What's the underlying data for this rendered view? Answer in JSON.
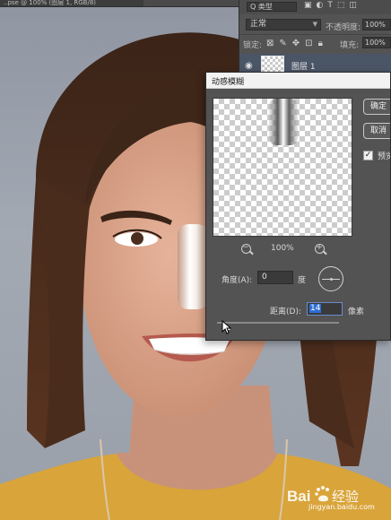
{
  "document_tab": {
    "title": "..pse @ 100% (图层 1, RGB/8)"
  },
  "layers_panel": {
    "filter_kind": "Q 类型",
    "blend_mode": "正常",
    "opacity_label": "不透明度:",
    "opacity_value": "100%",
    "lock_label": "锁定:",
    "fill_label": "填充:",
    "fill_value": "100%",
    "layer_name": "图层 1"
  },
  "dialog": {
    "title": "动感模糊",
    "ok_label": "确定",
    "cancel_label": "取消",
    "preview_label": "预览",
    "preview_checked": true,
    "zoom_level": "100%",
    "angle_label": "角度(A):",
    "angle_value": "0",
    "angle_unit": "度",
    "distance_label": "距离(D):",
    "distance_value": "14",
    "distance_unit": "像素"
  },
  "watermark": {
    "brand": "Baidu 经验",
    "url": "jingyan.baidu.com"
  },
  "colors": {
    "panel_bg": "#535353",
    "selection_blue": "#2f6fd6",
    "selected_layer": "#4a5566"
  }
}
